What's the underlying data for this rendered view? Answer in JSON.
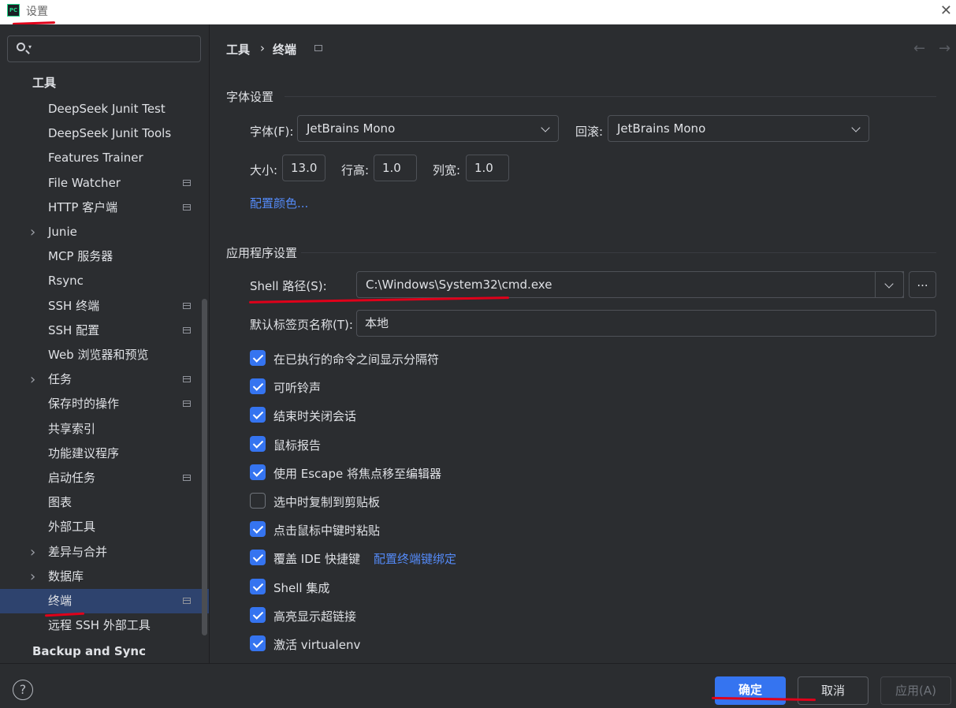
{
  "window": {
    "title": "设置",
    "app_icon": "PC"
  },
  "sidebar": {
    "search_placeholder": "",
    "group_tools": "工具",
    "items": [
      {
        "label": "DeepSeek Junit Test",
        "arrow": false,
        "proj": false
      },
      {
        "label": "DeepSeek Junit Tools",
        "arrow": false,
        "proj": false
      },
      {
        "label": "Features Trainer",
        "arrow": false,
        "proj": false
      },
      {
        "label": "File Watcher",
        "arrow": false,
        "proj": true
      },
      {
        "label": "HTTP 客户端",
        "arrow": false,
        "proj": true
      },
      {
        "label": "Junie",
        "arrow": true,
        "proj": false
      },
      {
        "label": "MCP 服务器",
        "arrow": false,
        "proj": false
      },
      {
        "label": "Rsync",
        "arrow": false,
        "proj": false
      },
      {
        "label": "SSH 终端",
        "arrow": false,
        "proj": true
      },
      {
        "label": "SSH 配置",
        "arrow": false,
        "proj": true
      },
      {
        "label": "Web 浏览器和预览",
        "arrow": false,
        "proj": false
      },
      {
        "label": "任务",
        "arrow": true,
        "proj": true
      },
      {
        "label": "保存时的操作",
        "arrow": false,
        "proj": true
      },
      {
        "label": "共享索引",
        "arrow": false,
        "proj": false
      },
      {
        "label": "功能建议程序",
        "arrow": false,
        "proj": false
      },
      {
        "label": "启动任务",
        "arrow": false,
        "proj": true
      },
      {
        "label": "图表",
        "arrow": false,
        "proj": false
      },
      {
        "label": "外部工具",
        "arrow": false,
        "proj": false
      },
      {
        "label": "差异与合并",
        "arrow": true,
        "proj": false
      },
      {
        "label": "数据库",
        "arrow": true,
        "proj": false
      },
      {
        "label": "终端",
        "arrow": false,
        "proj": true,
        "selected": true
      },
      {
        "label": "远程 SSH 外部工具",
        "arrow": false,
        "proj": false
      }
    ],
    "group_backup": "Backup and Sync"
  },
  "breadcrumb": {
    "parent": "工具",
    "separator": "›",
    "current": "终端"
  },
  "font_section": {
    "title": "字体设置",
    "font_label": "字体(F):",
    "font_value": "JetBrains Mono",
    "fallback_label": "回滚:",
    "fallback_value": "JetBrains Mono",
    "size_label": "大小:",
    "size_value": "13.0",
    "line_height_label": "行高:",
    "line_height_value": "1.0",
    "col_width_label": "列宽:",
    "col_width_value": "1.0",
    "color_link": "配置颜色..."
  },
  "app_section": {
    "title": "应用程序设置",
    "shell_label": "Shell 路径(S):",
    "shell_value": "C:\\Windows\\System32\\cmd.exe",
    "browse_label": "...",
    "tab_name_label": "默认标签页名称(T):",
    "tab_name_value": "本地",
    "checkboxes": [
      {
        "label": "在已执行的命令之间显示分隔符",
        "checked": true
      },
      {
        "label": "可听铃声",
        "checked": true
      },
      {
        "label": "结束时关闭会话",
        "checked": true
      },
      {
        "label": "鼠标报告",
        "checked": true
      },
      {
        "label": "使用 Escape 将焦点移至编辑器",
        "checked": true
      },
      {
        "label": "选中时复制到剪贴板",
        "checked": false
      },
      {
        "label": "点击鼠标中键时粘贴",
        "checked": true
      },
      {
        "label": "覆盖 IDE 快捷键",
        "checked": true,
        "link": "配置终端键绑定"
      },
      {
        "label": "Shell 集成",
        "checked": true
      },
      {
        "label": "高亮显示超链接",
        "checked": true
      },
      {
        "label": "激活 virtualenv",
        "checked": true
      }
    ]
  },
  "footer": {
    "help": "?",
    "ok": "确定",
    "cancel": "取消",
    "apply": "应用(A)"
  },
  "colors": {
    "accent": "#3574f0",
    "link": "#548af7",
    "annotation_red": "#e0001a",
    "selection": "#2e436e"
  }
}
